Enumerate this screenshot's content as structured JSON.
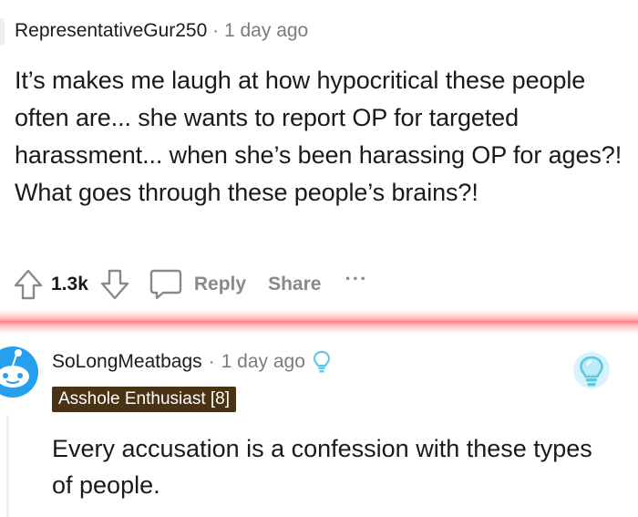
{
  "comment1": {
    "username": "RepresentativeGur250",
    "separator": "·",
    "time": "1 day ago",
    "body": "It’s makes me laugh at how hypocritical these people often are... she wants to report OP for targeted harassment... when she’s been harassing OP for ages?! What goes through these people’s brains?!",
    "votes": "1.3k",
    "reply_label": "Reply",
    "share_label": "Share",
    "more_label": "···",
    "icons": [
      "upvote-icon",
      "downvote-icon",
      "comment-bubble-icon",
      "more-icon"
    ]
  },
  "comment2": {
    "username": "SoLongMeatbags",
    "separator": "·",
    "time": "1 day ago",
    "flair": "Asshole Enthusiast [8]",
    "body": "Every accusation is a confession with these types of people.",
    "icons": [
      "avatar-icon",
      "lightbulb-icon",
      "lightbulb-award-icon"
    ]
  },
  "colors": {
    "text": "#1a1a1b",
    "meta": "#7c7c7c",
    "action": "#878a8c",
    "flair_bg": "#4a3214",
    "highlight": "#ff6e6e",
    "bulb": "#5ec8e5"
  }
}
